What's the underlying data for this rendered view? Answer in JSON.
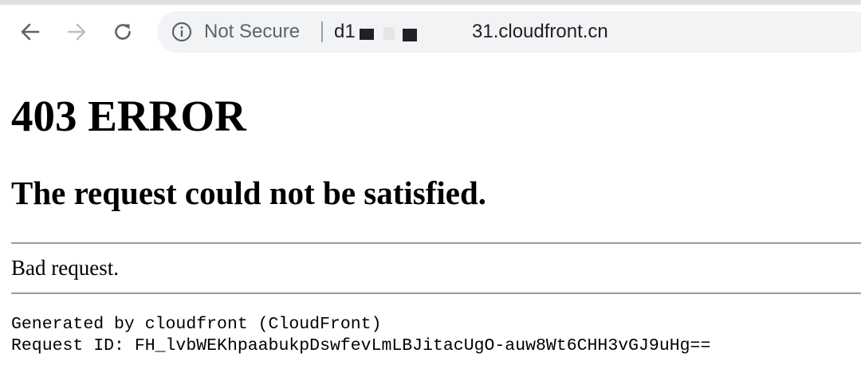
{
  "browser": {
    "security_label": "Not Secure",
    "url_prefix": "d1",
    "url_suffix": "31.cloudfront.cn",
    "icons": {
      "back": "back-arrow-icon",
      "forward": "forward-arrow-icon",
      "reload": "reload-icon",
      "security": "info-icon"
    }
  },
  "page": {
    "title": "403 ERROR",
    "subtitle": "The request could not be satisfied.",
    "message": "Bad request.",
    "generated_by": "Generated by cloudfront (CloudFront)",
    "request_id": "Request ID: FH_lvbWEKhpaabukpDswfevLmLBJitacUgO-auw8Wt6CHH3vGJ9uHg=="
  },
  "colors": {
    "omnibox_bg": "#f1f3f4",
    "icon_gray": "#5f6368",
    "rule_gray": "#9b9b9b"
  }
}
